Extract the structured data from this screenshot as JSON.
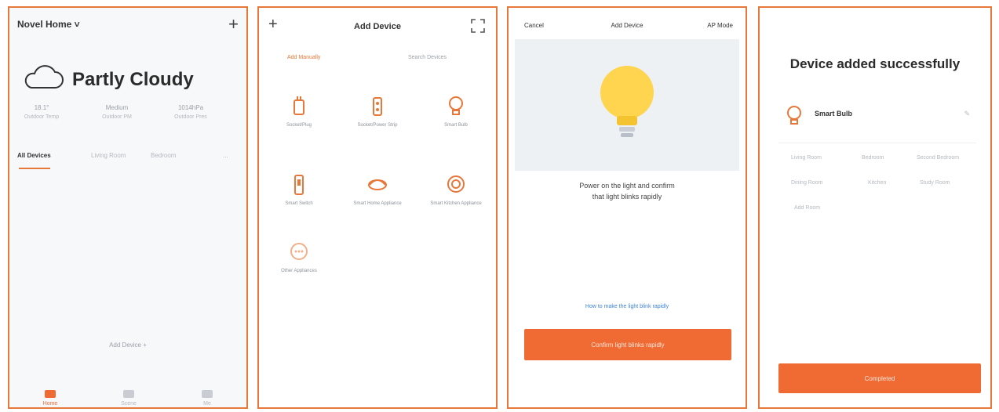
{
  "panel1": {
    "home_title": "Novel Home ˅",
    "add_icon": "plus-icon",
    "weather": "Partly Cloudy",
    "weather_icon": "cloud-icon",
    "stats": [
      {
        "value": "18.1°",
        "label": "Outdoor Temp"
      },
      {
        "value": "Medium",
        "label": "Outdoor PM"
      },
      {
        "value": "1014hPa",
        "label": "Outdoor Pres"
      }
    ],
    "tabs": [
      "All Devices",
      "Living Room",
      "Bedroom",
      "..."
    ],
    "center_note": "Add Device +",
    "nav": [
      "Home",
      "Scene",
      "Me"
    ]
  },
  "panel2": {
    "title": "Add Device",
    "tab_manual": "Add Manually",
    "tab_auto": "Search Devices",
    "devices": [
      {
        "label": "Socket/Plug"
      },
      {
        "label": "Socket/Power Strip"
      },
      {
        "label": "Smart Bulb"
      },
      {
        "label": "Smart Switch"
      },
      {
        "label": "Smart Home Appliance"
      },
      {
        "label": "Smart Kitchen Appliance"
      },
      {
        "label": "Other Appliances"
      }
    ]
  },
  "panel3": {
    "cancel": "Cancel",
    "title": "Add Device",
    "mode": "AP Mode",
    "instructions_line1": "Power on the light and confirm",
    "instructions_line2": "that light blinks rapidly",
    "link": "How to make the light blink rapidly",
    "cta": "Confirm light blinks rapidly"
  },
  "panel4": {
    "title": "Device added successfully",
    "device_name": "Smart Bulb",
    "edit_icon": "edit-icon",
    "rows": [
      [
        "Living Room",
        "Bedroom",
        "Second Bedroom"
      ],
      [
        "Dining Room",
        "Kitchen",
        "Study Room"
      ],
      [
        "Add Room"
      ]
    ],
    "cta": "Completed"
  },
  "colors": {
    "accent": "#f06a33",
    "frame": "#e8773a",
    "link": "#3d84d9"
  }
}
